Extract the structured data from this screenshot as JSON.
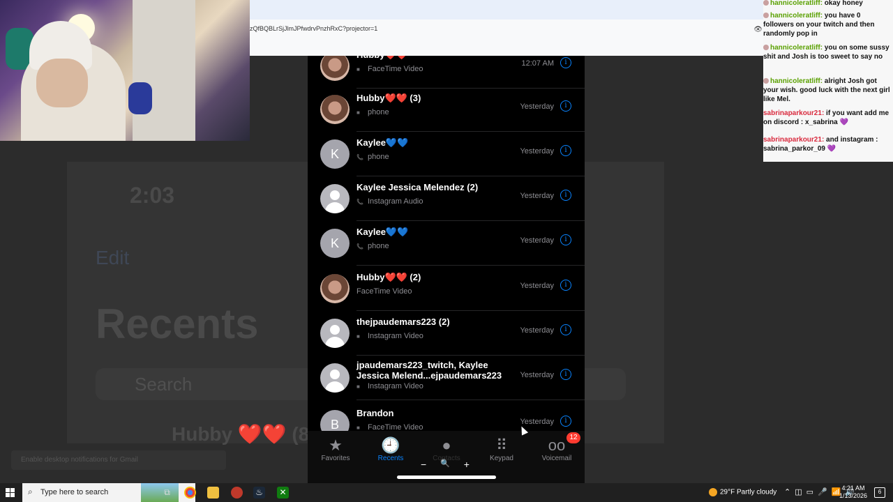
{
  "background_app": {
    "time": "2:03",
    "edit_label": "Edit",
    "title": "Recents",
    "search_placeholder": "Search",
    "partial_name": "Hubby ❤️❤️ (8",
    "notification_text": "Enable desktop notifications for Gmail"
  },
  "browser": {
    "url": "zQfBQBLrSjJlmJPfwdrvPnzhRxC?projector=1"
  },
  "recents": [
    {
      "name": "Hubby❤️❤️",
      "type": "FaceTime Video",
      "type_icon": "video-icon",
      "when": "12:07 AM",
      "avatar": "photo",
      "initial": ""
    },
    {
      "name": "Hubby❤️❤️ (3)",
      "type": "phone",
      "type_icon": "video-icon",
      "when": "Yesterday",
      "avatar": "photo",
      "initial": ""
    },
    {
      "name": "Kaylee💙💙",
      "type": "phone",
      "type_icon": "phone-icon",
      "when": "Yesterday",
      "avatar": "letter",
      "initial": "K"
    },
    {
      "name": "Kaylee Jessica Melendez (2)",
      "type": "Instagram Audio",
      "type_icon": "phone-icon",
      "when": "Yesterday",
      "avatar": "generic",
      "initial": ""
    },
    {
      "name": "Kaylee💙💙",
      "type": "phone",
      "type_icon": "phone-icon",
      "when": "Yesterday",
      "avatar": "letter",
      "initial": "K"
    },
    {
      "name": "Hubby❤️❤️ (2)",
      "type": "FaceTime Video",
      "type_icon": "",
      "when": "Yesterday",
      "avatar": "photo",
      "initial": ""
    },
    {
      "name": "thejpaudemars223 (2)",
      "type": "Instagram Video",
      "type_icon": "video-icon",
      "when": "Yesterday",
      "avatar": "generic",
      "initial": ""
    },
    {
      "name": "jpaudemars223_twitch, Kaylee Jessica Melend...ejpaudemars223",
      "type": "Instagram Video",
      "type_icon": "video-icon",
      "when": "Yesterday",
      "avatar": "generic",
      "initial": ""
    },
    {
      "name": "Brandon",
      "type": "FaceTime Video",
      "type_icon": "video-icon",
      "when": "Yesterday",
      "avatar": "letter",
      "initial": "B"
    }
  ],
  "tabbar": {
    "favorites": "Favorites",
    "recents": "Recents",
    "contacts": "Contacts",
    "keypad": "Keypad",
    "voicemail": "Voicemail",
    "voicemail_badge": "12"
  },
  "zoom": {
    "minus": "−",
    "icon": "🔍",
    "plus": "+"
  },
  "chat": [
    {
      "user": "hannicoleratliff",
      "text": "okay honey",
      "color": "green"
    },
    {
      "user": "hannicoleratliff",
      "text": "you have 0 followers on your twitch and then randomly pop in",
      "color": "green"
    },
    {
      "user": "hannicoleratliff",
      "text": "you on some sussy shit and Josh is too sweet to say no",
      "color": "green"
    },
    {
      "user": "hannicoleratliff",
      "text": "alright Josh got your wish. good luck with the next girl like Mel.",
      "color": "green"
    },
    {
      "user": "sabrinaparkour21",
      "text": "if you want add me on discord : x_sabrina 💜",
      "color": "pink"
    },
    {
      "user": "sabrinaparkour21",
      "text": "and instagram : sabrina_parkor_09 💜",
      "color": "pink"
    }
  ],
  "taskbar": {
    "search_placeholder": "Type here to search",
    "weather": "29°F  Partly cloudy",
    "time": "4:21 AM",
    "date": "1/13/2026",
    "notif_count": "6"
  }
}
